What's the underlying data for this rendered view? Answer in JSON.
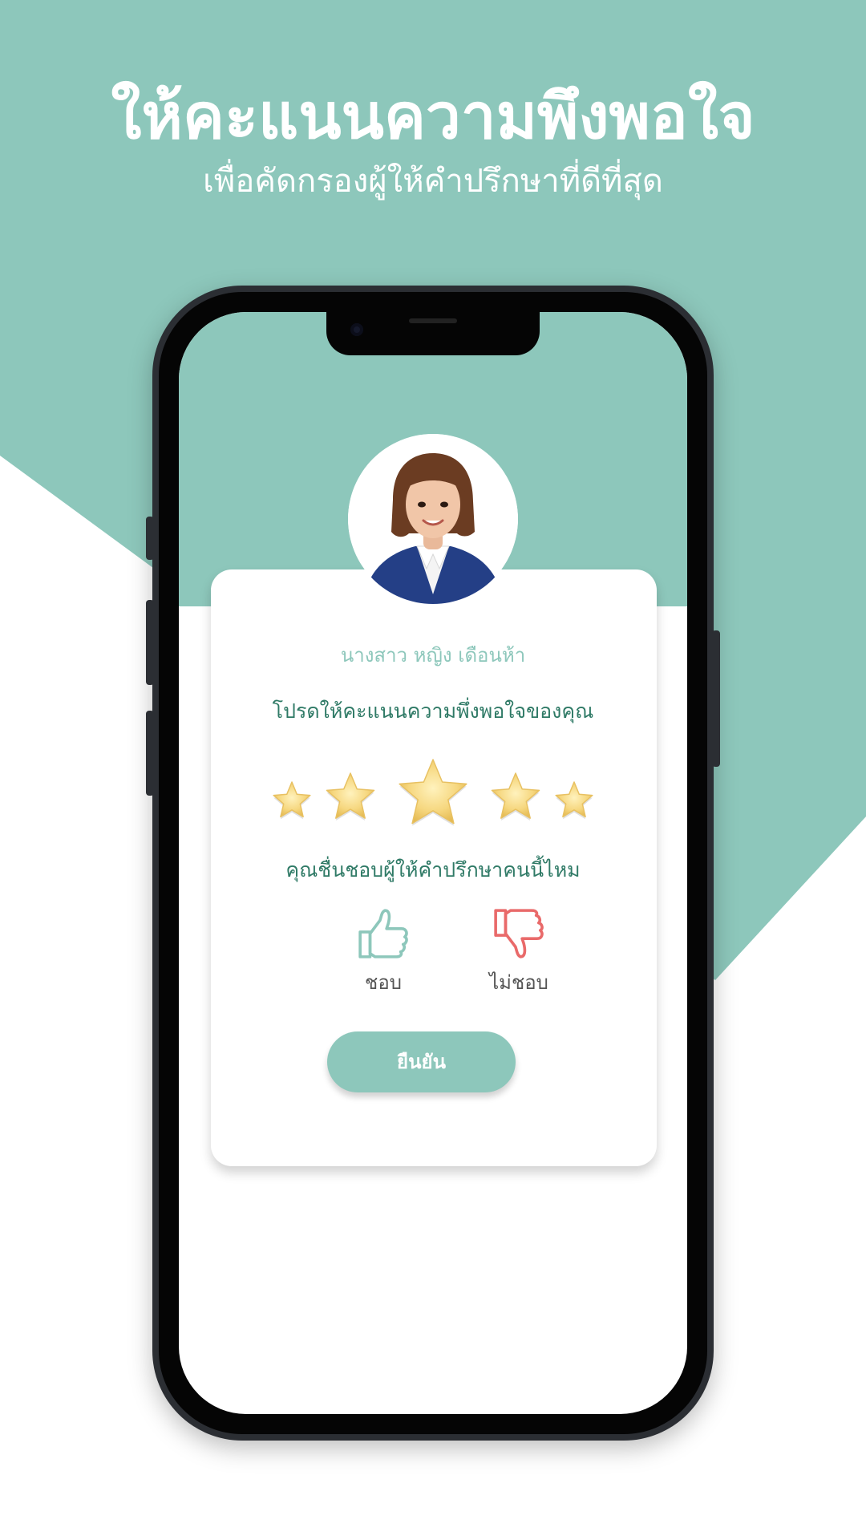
{
  "colors": {
    "accent": "#8dc7bb",
    "text_green": "#2f7a66",
    "star": "#f6d77f",
    "dislike": "#e96a6a"
  },
  "hero": {
    "title": "ให้คะแนนความพึงพอใจ",
    "subtitle": "เพื่อคัดกรองผู้ให้คำปรึกษาที่ดีที่สุด"
  },
  "rating_card": {
    "consultant_name": "นางสาว หญิง เดือนห้า",
    "rating_prompt": "โปรดให้คะแนนความพึ่งพอใจของคุณ",
    "star_count": 5,
    "stars": [
      "star-icon",
      "star-icon",
      "star-icon",
      "star-icon",
      "star-icon"
    ],
    "like_question": "คุณชื่นชอบผู้ให้คำปรึกษาคนนี้ไหม",
    "like_label": "ชอบ",
    "dislike_label": "ไม่ชอบ",
    "confirm_label": "ยืนยัน"
  }
}
